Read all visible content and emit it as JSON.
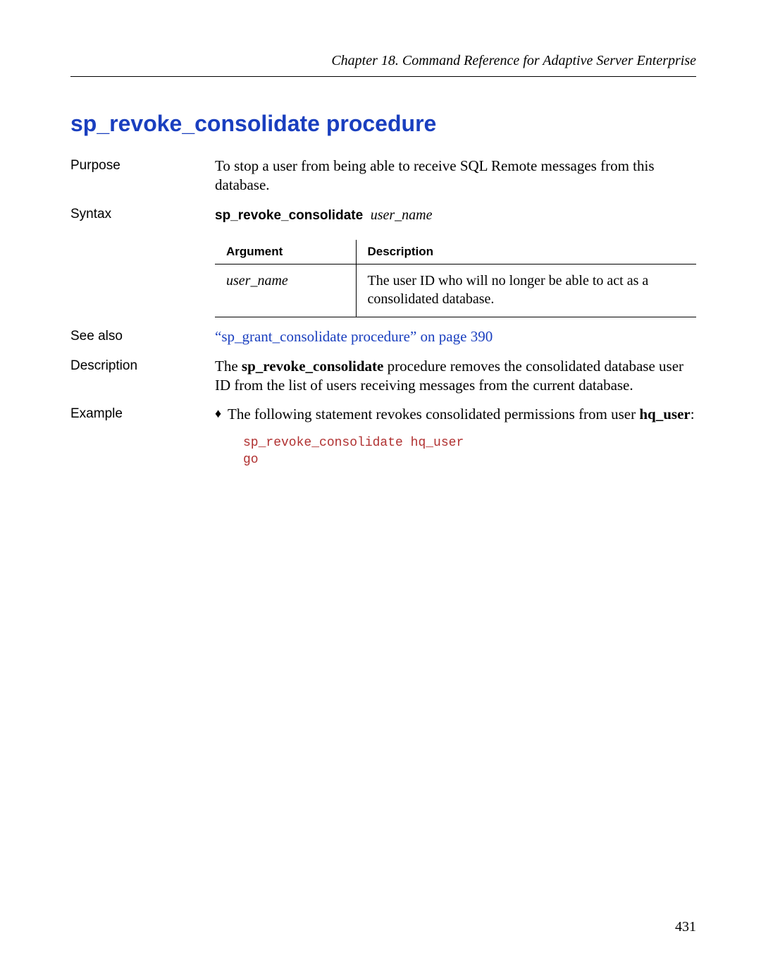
{
  "chapter_header": "Chapter 18.  Command Reference for Adaptive Server Enterprise",
  "title": "sp_revoke_consolidate procedure",
  "sections": {
    "purpose": {
      "label": "Purpose",
      "text": "To stop a user from being able to receive SQL Remote messages from this database."
    },
    "syntax": {
      "label": "Syntax",
      "command": "sp_revoke_consolidate",
      "arg": "user_name",
      "table": {
        "header_arg": "Argument",
        "header_desc": "Description",
        "rows": [
          {
            "arg": "user_name",
            "desc": "The user ID who will no longer be able to act as a consolidated database."
          }
        ]
      }
    },
    "see_also": {
      "label": "See also",
      "link_text": "“sp_grant_consolidate procedure” on page 390"
    },
    "description": {
      "label": "Description",
      "prefix": "The ",
      "bold": "sp_revoke_consolidate",
      "suffix": " procedure removes the consolidated database user ID from the list of users receiving messages from the current database."
    },
    "example": {
      "label": "Example",
      "bullet_prefix": "The following statement revokes consolidated permissions from user ",
      "bullet_bold": "hq_user",
      "bullet_suffix": ":",
      "code": "sp_revoke_consolidate hq_user\ngo"
    }
  },
  "page_number": "431"
}
